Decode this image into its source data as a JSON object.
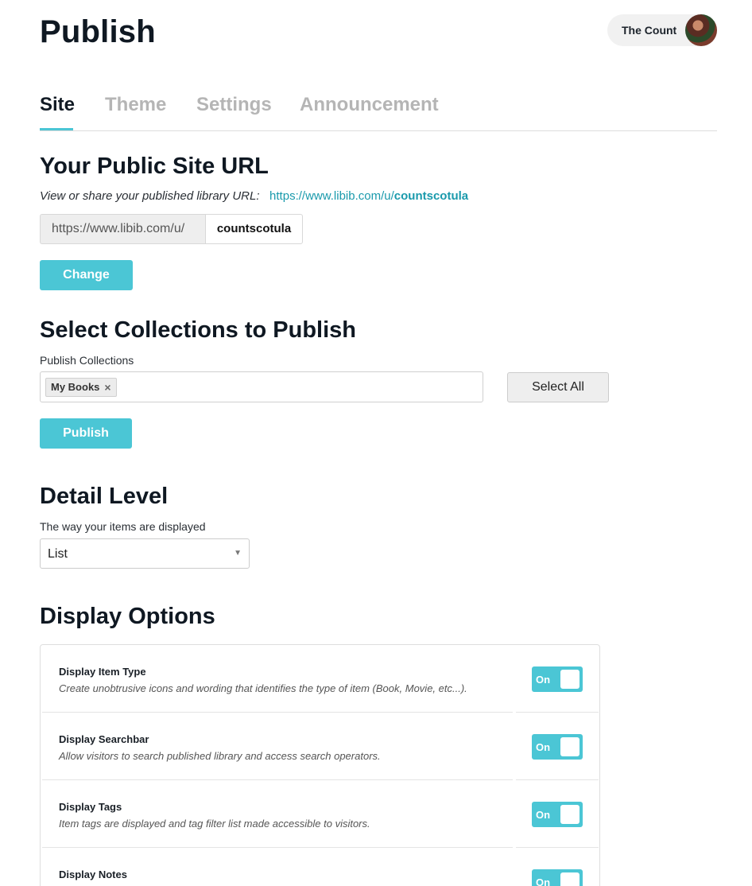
{
  "header": {
    "title": "Publish",
    "user_name": "The Count"
  },
  "tabs": [
    {
      "label": "Site",
      "active": true
    },
    {
      "label": "Theme",
      "active": false
    },
    {
      "label": "Settings",
      "active": false
    },
    {
      "label": "Announcement",
      "active": false
    }
  ],
  "site_url": {
    "heading": "Your Public Site URL",
    "description": "View or share your published library URL:",
    "link_prefix": "https://www.libib.com/u/",
    "link_slug": "countscotula",
    "input_prefix": "https://www.libib.com/u/",
    "input_value": "countscotula",
    "change_button": "Change"
  },
  "collections": {
    "heading": "Select Collections to Publish",
    "label": "Publish Collections",
    "selected": [
      "My Books"
    ],
    "remove_icon": "×",
    "select_all_button": "Select All",
    "publish_button": "Publish"
  },
  "detail_level": {
    "heading": "Detail Level",
    "label": "The way your items are displayed",
    "selected": "List",
    "caret": "▼"
  },
  "display_options": {
    "heading": "Display Options",
    "items": [
      {
        "title": "Display Item Type",
        "description": "Create unobtrusive icons and wording that identifies the type of item (Book, Movie, etc...).",
        "toggle": "On"
      },
      {
        "title": "Display Searchbar",
        "description": "Allow visitors to search published library and access search operators.",
        "toggle": "On"
      },
      {
        "title": "Display Tags",
        "description": "Item tags are displayed and tag filter list made accessible to visitors.",
        "toggle": "On"
      },
      {
        "title": "Display Notes",
        "description": "",
        "toggle": "On"
      }
    ]
  },
  "colors": {
    "accent": "#4bc6d5",
    "link": "#1a9aac",
    "heading": "#0f1822",
    "inactive_tab": "#b5b5b5"
  }
}
